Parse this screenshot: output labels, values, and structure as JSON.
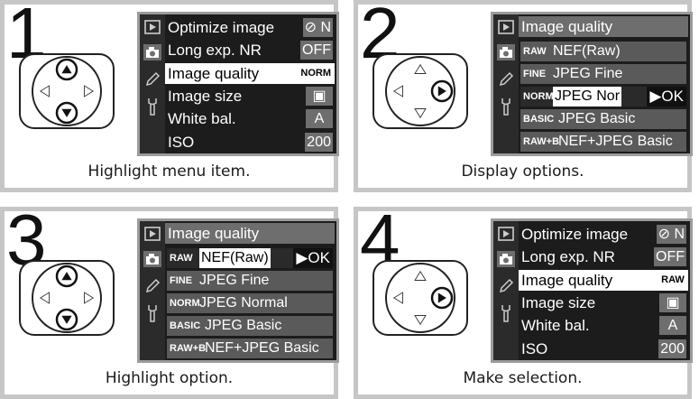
{
  "panels": [
    {
      "number": "1",
      "caption": "Highlight menu item.",
      "dpad_pressed": [
        "up",
        "down"
      ],
      "menu": [
        {
          "label": "Optimize image",
          "value": "⊘ N",
          "highlight": false
        },
        {
          "label": "Long exp. NR",
          "value": "OFF",
          "highlight": false
        },
        {
          "label": "Image quality",
          "value": "NORM",
          "highlight": true
        },
        {
          "label": "Image size",
          "value": "▣",
          "highlight": false
        },
        {
          "label": "White bal.",
          "value": "A",
          "highlight": false
        },
        {
          "label": "ISO",
          "value": "200",
          "highlight": false
        }
      ]
    },
    {
      "number": "2",
      "caption": "Display options.",
      "dpad_pressed": [
        "right"
      ],
      "title": "Image quality",
      "options": [
        {
          "tag": "RAW",
          "text": "NEF(Raw)",
          "highlight": false,
          "ok": ""
        },
        {
          "tag": "FINE",
          "text": "JPEG Fine",
          "highlight": false,
          "ok": ""
        },
        {
          "tag": "NORM",
          "text": "JPEG Nor",
          "highlight": true,
          "ok": "▶OK"
        },
        {
          "tag": "BASIC",
          "text": "JPEG Basic",
          "highlight": false,
          "ok": ""
        },
        {
          "tag": "RAW+B",
          "text": "NEF+JPEG Basic",
          "highlight": false,
          "ok": ""
        }
      ]
    },
    {
      "number": "3",
      "caption": "Highlight option.",
      "dpad_pressed": [
        "up",
        "down"
      ],
      "title": "Image quality",
      "options": [
        {
          "tag": "RAW",
          "text": "NEF(Raw)",
          "highlight": true,
          "ok": "▶OK"
        },
        {
          "tag": "FINE",
          "text": "JPEG Fine",
          "highlight": false,
          "ok": ""
        },
        {
          "tag": "NORM",
          "text": "JPEG Normal",
          "highlight": false,
          "ok": ""
        },
        {
          "tag": "BASIC",
          "text": "JPEG Basic",
          "highlight": false,
          "ok": ""
        },
        {
          "tag": "RAW+B",
          "text": "NEF+JPEG Basic",
          "highlight": false,
          "ok": ""
        }
      ]
    },
    {
      "number": "4",
      "caption": "Make selection.",
      "dpad_pressed": [
        "right"
      ],
      "menu": [
        {
          "label": "Optimize image",
          "value": "⊘ N",
          "highlight": false
        },
        {
          "label": "Long exp. NR",
          "value": "OFF",
          "highlight": false
        },
        {
          "label": "Image quality",
          "value": "RAW",
          "highlight": true
        },
        {
          "label": "Image size",
          "value": "▣",
          "highlight": false
        },
        {
          "label": "White bal.",
          "value": "A",
          "highlight": false
        },
        {
          "label": "ISO",
          "value": "200",
          "highlight": false
        }
      ]
    }
  ],
  "colors": {
    "panel_border": "#c6c6c6",
    "screen_bg": "#1c1c1c",
    "grey_row": "#6e6e6e",
    "highlight": "#ffffff"
  }
}
